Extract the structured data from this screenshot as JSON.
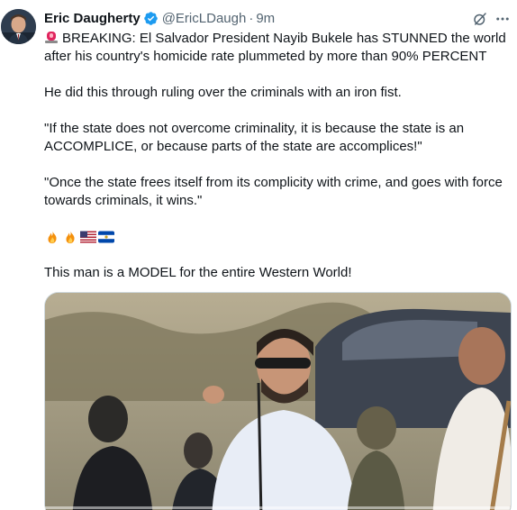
{
  "author": {
    "display_name": "Eric Daugherty",
    "handle": "@EricLDaugh",
    "separator": "·",
    "time": "9m",
    "verified": true
  },
  "tweet": {
    "line1": "BREAKING: El Salvador President Nayib Bukele has STUNNED the world after his country's homicide rate plummeted by more than 90% PERCENT",
    "para2": "He did this through ruling over the criminals with an iron fist.",
    "para3": "\"If the state does not overcome criminality, it is because the state is an ACCOMPLICE, or because parts of the state are accomplices!\"",
    "para4": "\"Once the state frees itself from its complicity with crime, and goes with force towards criminals, it wins.\"",
    "emojis": [
      "fire-icon",
      "fire-icon",
      "us-flag-icon",
      "el-salvador-flag-icon"
    ],
    "para5": "This man is a MODEL for the entire Western World!"
  },
  "icons": {
    "siren": "siren-icon",
    "grok": "grok-icon",
    "more": "more-icon",
    "verified": "verified-badge-icon"
  },
  "colors": {
    "accent": "#1d9bf0",
    "text": "#0f1419",
    "secondary": "#536471"
  },
  "video": {
    "progress_fraction": 0.0
  }
}
